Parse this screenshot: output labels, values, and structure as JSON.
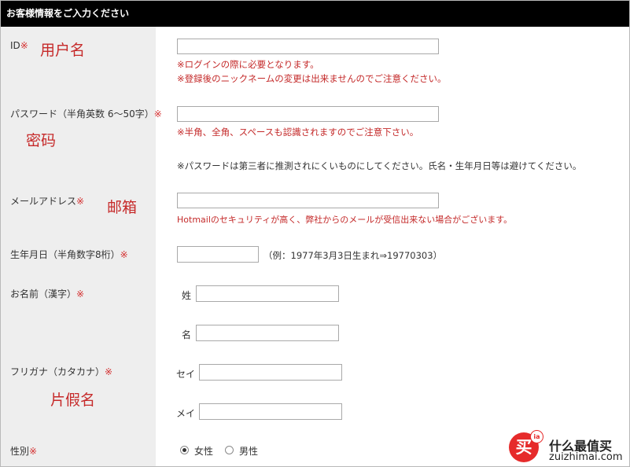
{
  "header": {
    "title": "お客様情報をご入力ください"
  },
  "fields": {
    "id": {
      "label": "ID",
      "req": "※",
      "annotation": "用户名",
      "value": "",
      "notes": [
        "※ログインの際に必要となります。",
        "※登録後のニックネームの変更は出来ませんのでご注意ください。"
      ]
    },
    "password": {
      "label": "パスワード（半角英数 6～50字）",
      "req": "※",
      "annotation": "密码",
      "value": "",
      "note_red": "※半角、全角、スペースも認識されますのでご注意下さい。",
      "note_dark": "※パスワードは第三者に推測されにくいものにしてください。氏名・生年月日等は避けてください。"
    },
    "email": {
      "label": "メールアドレス",
      "req": "※",
      "annotation": "邮箱",
      "value": "",
      "note": "Hotmailのセキュリティが高く、弊社からのメールが受信出来ない場合がございます。"
    },
    "birthday": {
      "label": "生年月日（半角数字8桁）",
      "req": "※",
      "value": "",
      "example": "（例：1977年3月3日生まれ⇒19770303）"
    },
    "name": {
      "label": "お名前（漢字）",
      "req": "※",
      "last_label": "姓",
      "first_label": "名",
      "last_value": "",
      "first_value": ""
    },
    "furigana": {
      "label": "フリガナ（カタカナ）",
      "req": "※",
      "annotation": "片假名",
      "last_label": "セイ",
      "first_label": "メイ",
      "last_value": "",
      "first_value": ""
    },
    "gender": {
      "label": "性別",
      "req": "※",
      "options": [
        "女性",
        "男性"
      ],
      "selected": "女性"
    }
  },
  "watermark": {
    "cn": "什么最值买",
    "en": "zuizhimai.com",
    "icon_char": "买",
    "badge": "ia"
  }
}
